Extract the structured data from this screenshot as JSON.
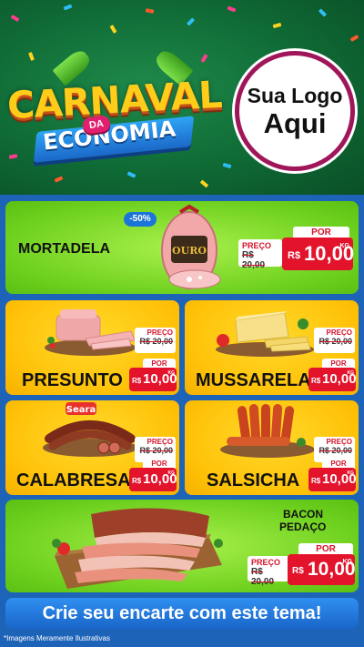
{
  "header": {
    "title_word1": "CARNAVAL",
    "title_da": "DA",
    "title_word2": "ECONOMIA",
    "logo_line1": "Sua Logo",
    "logo_line2": "Aqui"
  },
  "labels": {
    "preco": "PREÇO",
    "por": "POR",
    "currency": "R$",
    "unit": "KG"
  },
  "products": {
    "mortadela": {
      "name": "MORTADELA",
      "discount": "-50%",
      "brand": "OURO",
      "old_price": "R$ 20,00",
      "price": "10,00"
    },
    "presunto": {
      "name": "PRESUNTO",
      "old_price": "R$ 20,00",
      "price": "10,00"
    },
    "mussarela": {
      "name": "MUSSARELA",
      "old_price": "R$ 20,00",
      "price": "10,00"
    },
    "calabresa": {
      "name": "CALABRESA",
      "brand": "Seara",
      "old_price": "R$ 20,00",
      "price": "10,00"
    },
    "salsicha": {
      "name": "SALSICHA",
      "old_price": "R$ 20,00",
      "price": "10,00"
    },
    "bacon": {
      "name_line1": "BACON",
      "name_line2": "PEDAÇO",
      "old_price": "R$ 20,00",
      "price": "10,00"
    }
  },
  "cta": {
    "label": "Crie seu encarte com este tema!"
  },
  "footnote": "*Imagens Meramente Ilustrativas",
  "colors": {
    "header_green": "#0f6a35",
    "card_green": "#6fd11f",
    "card_yellow": "#ffc107",
    "price_red": "#e3132c",
    "background_blue": "#1d63b8"
  }
}
